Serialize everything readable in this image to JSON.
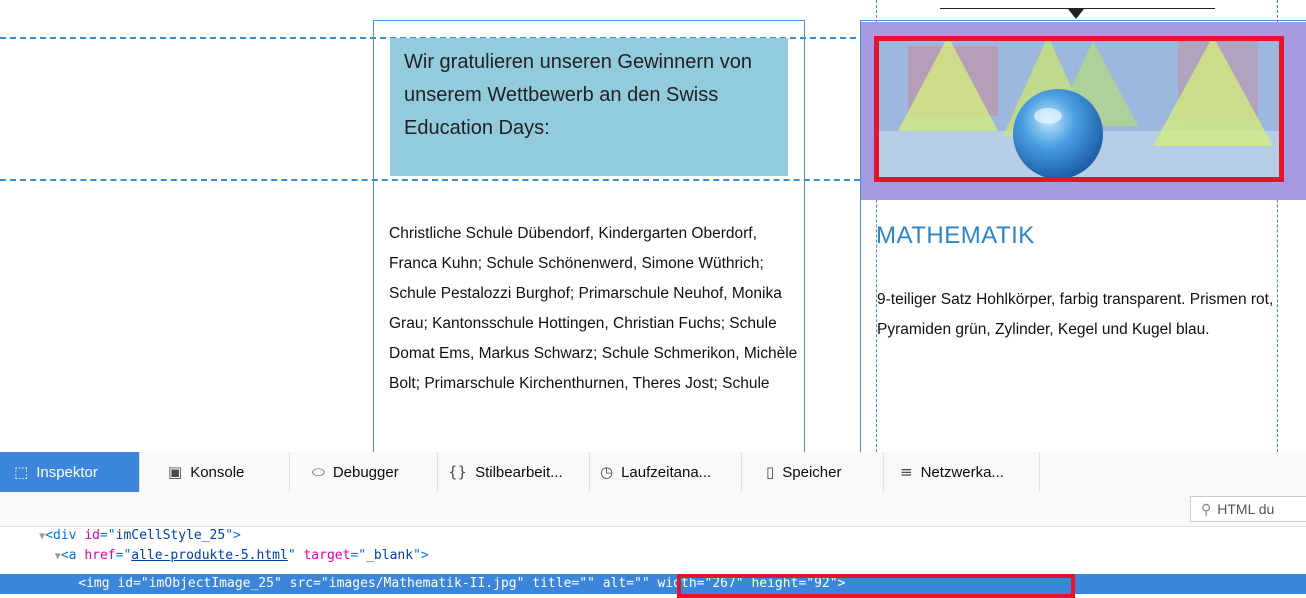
{
  "page": {
    "headline": "Wir gratulieren unseren Gewinnern von unserem Wettbewerb an den Swiss Education Days:",
    "winners_text": "Christliche Schule Dübendorf, Kindergarten Oberdorf, Franca Kuhn; Schule Schönenwerd, Simone Wüthrich; Schule Pestalozzi Burghof; Primarschule Neuhof, Monika Grau; Kantonsschule Hottingen, Christian Fuchs; Schule Domat Ems, Markus Schwarz; Schule Schmerikon, Michèle Bolt; Primarschule Kirchenthurnen, Theres Jost; Schule",
    "product_title": "MATHEMATIK",
    "product_description": "9-teiliger Satz Hohlkörper, farbig transparent. Prismen rot, Pyramiden grün, Zylinder, Kegel und Kugel blau."
  },
  "devtools": {
    "tabs": [
      {
        "label": "Inspektor",
        "icon": "inspector-icon"
      },
      {
        "label": "Konsole",
        "icon": "console-icon"
      },
      {
        "label": "Debugger",
        "icon": "debugger-icon"
      },
      {
        "label": "Stilbearbeit...",
        "icon": "style-editor-icon"
      },
      {
        "label": "Laufzeitana...",
        "icon": "performance-icon"
      },
      {
        "label": "Speicher",
        "icon": "memory-icon"
      },
      {
        "label": "Netzwerka...",
        "icon": "network-icon"
      }
    ],
    "search_placeholder": "HTML du",
    "dom_lines": [
      {
        "tag": "div",
        "attr1_name": "id",
        "attr1_value": "imCellStyle_25"
      },
      {
        "tag": "a",
        "attr1_name": "href",
        "attr1_value": "alle-produkte-5.html",
        "attr2_name": "target",
        "attr2_value": "_blank"
      },
      {
        "tag": "img",
        "id_value": "imObjectImage_25",
        "src_value": "images/Mathematik-II.jpg",
        "title_value": "",
        "alt_value": "",
        "width_value": "267",
        "height_value": "92"
      }
    ]
  },
  "colors": {
    "accent_blue": "#3b86db",
    "highlight_red": "#e3142b",
    "headline_bg": "#92cbdc",
    "image_overlay": "#a89ae0",
    "title_blue": "#2b86c8"
  }
}
